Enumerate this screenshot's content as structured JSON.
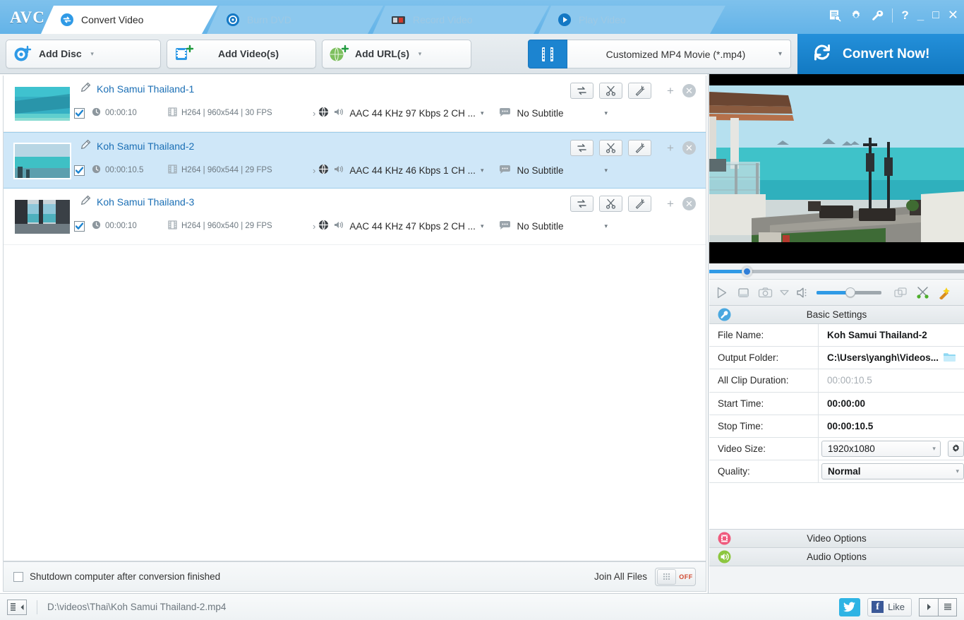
{
  "app": {
    "logo": "AVC"
  },
  "tabs": [
    {
      "label": "Convert Video",
      "icon": "convert-icon",
      "active": true
    },
    {
      "label": "Burn DVD",
      "icon": "disc-icon",
      "active": false
    },
    {
      "label": "Record Video",
      "icon": "camcorder-icon",
      "active": false
    },
    {
      "label": "Play Video",
      "icon": "play-circle-icon",
      "active": false
    }
  ],
  "window_buttons": {
    "list_icon": "list-note-icon",
    "gear_icon": "gear-icon",
    "wrench_icon": "wrench-icon",
    "help": "?",
    "minimize": "_",
    "maximize": "□",
    "close": "✕"
  },
  "toolbar": {
    "add_disc": "Add Disc",
    "add_video": "Add Video(s)",
    "add_url": "Add URL(s)",
    "profile": "Customized MP4 Movie (*.mp4)",
    "convert_now": "Convert Now!",
    "caret": "▾"
  },
  "files": [
    {
      "name": "Koh Samui Thailand-1",
      "duration": "00:00:10",
      "video": "H264 | 960x544 | 30 FPS",
      "audio": "AAC 44 KHz 97 Kbps 2 CH ...",
      "subtitle": "No Subtitle",
      "checked": true,
      "selected": false
    },
    {
      "name": "Koh Samui Thailand-2",
      "duration": "00:00:10.5",
      "video": "H264 | 960x544 | 29 FPS",
      "audio": "AAC 44 KHz 46 Kbps 1 CH ...",
      "subtitle": "No Subtitle",
      "checked": true,
      "selected": true
    },
    {
      "name": "Koh Samui Thailand-3",
      "duration": "00:00:10",
      "video": "H264 | 960x540 | 29 FPS",
      "audio": "AAC 44 KHz 47 Kbps 2 CH ...",
      "subtitle": "No Subtitle",
      "checked": true,
      "selected": false
    }
  ],
  "row_actions": {
    "convert_icon": "swap-arrows-icon",
    "trim_icon": "scissors-icon",
    "effect_icon": "magic-wand-icon",
    "add": "+",
    "remove": "✕"
  },
  "bottom_bar": {
    "shutdown_label": "Shutdown computer after conversion finished",
    "shutdown_checked": false,
    "join_label": "Join All Files",
    "join_state": "OFF"
  },
  "player": {
    "play_icon": "play-icon",
    "stop_icon": "stop-icon",
    "snapshot_icon": "camera-icon",
    "snapshot_caret": "▾",
    "volume_icon": "speaker-icon",
    "fullscreen_icon": "fullscreen-icon",
    "cut_icon": "scissors-green-icon",
    "effect_icon": "magic-wand-yellow-icon",
    "seek_percent": 15,
    "volume_percent": 52
  },
  "basic_settings": {
    "title": "Basic Settings",
    "icon": "wrench-blue-icon",
    "rows": [
      {
        "key": "File Name:",
        "value": "Koh Samui Thailand-2",
        "type": "text"
      },
      {
        "key": "Output Folder:",
        "value": "C:\\Users\\yangh\\Videos...",
        "type": "folder"
      },
      {
        "key": "All Clip Duration:",
        "value": "00:00:10.5",
        "type": "readonly"
      },
      {
        "key": "Start Time:",
        "value": "00:00:00",
        "type": "text"
      },
      {
        "key": "Stop Time:",
        "value": "00:00:10.5",
        "type": "text"
      },
      {
        "key": "Video Size:",
        "value": "1920x1080",
        "type": "select-gear"
      },
      {
        "key": "Quality:",
        "value": "Normal",
        "type": "select"
      }
    ]
  },
  "video_options": {
    "title": "Video Options",
    "icon": "film-red-icon"
  },
  "audio_options": {
    "title": "Audio Options",
    "icon": "speaker-green-icon"
  },
  "status_bar": {
    "list_icon": "list-toggle-icon",
    "path": "D:\\videos\\Thai\\Koh Samui Thailand-2.mp4",
    "twitter_icon": "twitter-icon",
    "facebook_like": "Like",
    "facebook_mark": "f",
    "expand_icon": "play-small-icon",
    "menu_icon": "lines-icon"
  },
  "colors": {
    "title_blue": "#63b3e8",
    "accent_blue": "#1c84d0",
    "selection": "#cfe7f8",
    "link": "#1b6fb5",
    "off_red": "#d1472e"
  }
}
